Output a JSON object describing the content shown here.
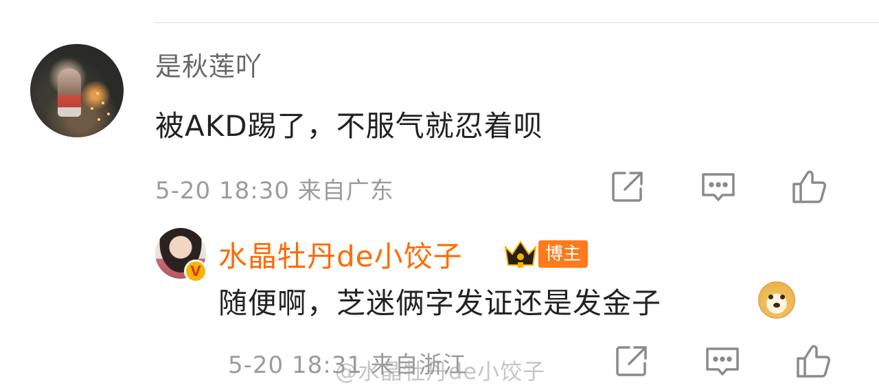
{
  "comment": {
    "username": "是秋莲吖",
    "text": "被AKD踢了，不服气就忍着呗",
    "meta": "5-20 18:30 来自广东",
    "icons": [
      "share-icon",
      "comment-icon",
      "like-icon"
    ]
  },
  "reply": {
    "username": "水晶牡丹de小饺子",
    "role_badge": "博主",
    "text": "随便啊，芝迷俩字发证还是发金子",
    "emoji": "doge-emoji",
    "meta": "5-20 18:31 来自浙江",
    "verified_badge": "V",
    "icons": [
      "share-icon",
      "comment-icon",
      "like-icon"
    ]
  },
  "watermark": "@水晶牡丹de小饺子",
  "colors": {
    "accent_name": "#ff6a00",
    "badge_bg": "#ff7a1a",
    "meta_text": "#9b9b9b"
  }
}
